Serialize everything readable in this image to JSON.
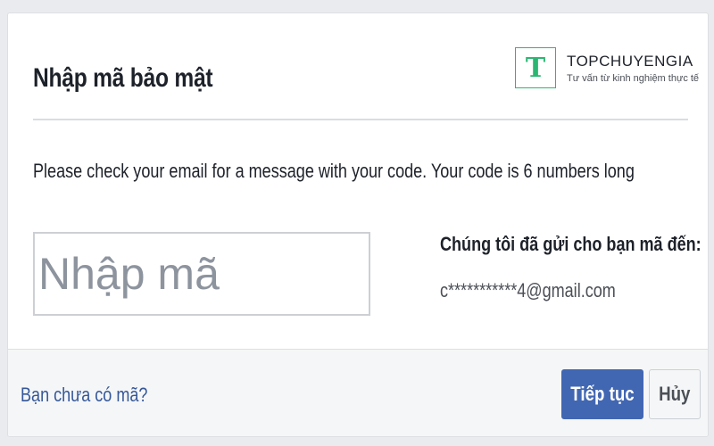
{
  "dialog": {
    "title": "Nhập mã bảo mật",
    "message": "Please check your email for a message with your code. Your code is 6 numbers long",
    "code_input": {
      "placeholder": "Nhập mã",
      "value": ""
    },
    "sent_label": "Chúng tôi đã gửi cho bạn mã đến:",
    "sent_email": "c***********4@gmail.com"
  },
  "logo": {
    "letter": "T",
    "name": "TOPCHUYENGIA",
    "tagline": "Tư vấn từ kinh nghiệm thực tế"
  },
  "footer": {
    "no_code_link": "Bạn chưa có mã?",
    "continue_label": "Tiếp tục",
    "cancel_label": "Hủy"
  },
  "colors": {
    "primary_button": "#4267b2",
    "link": "#365899",
    "logo_accent": "#2bb673"
  }
}
